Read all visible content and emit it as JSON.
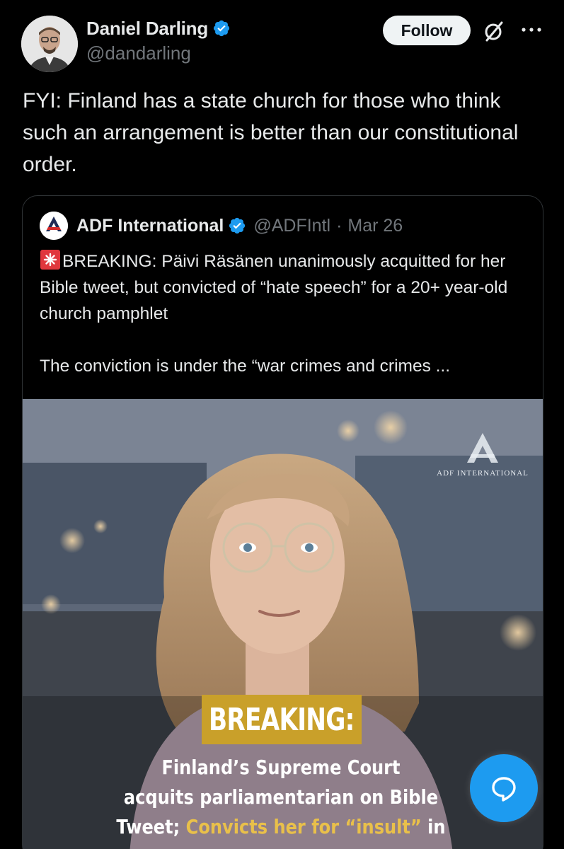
{
  "author": {
    "display_name": "Daniel Darling",
    "handle": "@dandarling",
    "verified": true
  },
  "actions": {
    "follow_label": "Follow"
  },
  "tweet": {
    "text": "FYI: Finland has a state church for those who think such an arrangement is better than our constitutional order."
  },
  "quote": {
    "author_name": "ADF International",
    "handle": "@ADFIntl",
    "separator": "·",
    "date": "Mar 26",
    "verified": true,
    "line1": "BREAKING: Päivi Räsänen unanimously acquitted for her Bible tweet, but convicted of “hate speech” for a 20+ year-old church pamphlet",
    "line2": "The conviction is under the “war crimes and crimes ..."
  },
  "media": {
    "watermark": "ADF INTERNATIONAL",
    "badge": "BREAKING:",
    "headline_1": "Finland’s Supreme Court",
    "headline_2": "acquits parliamentarian on Bible",
    "headline_3a": "Tweet;",
    "headline_3b": "Convicts her for “insult”",
    "headline_3c": "in"
  },
  "icons": {
    "verified": "verified-badge-icon",
    "grok": "grok-icon",
    "more": "more-icon",
    "siren": "siren-emoji-icon",
    "reply_fab": "chat-bubble-icon"
  },
  "colors": {
    "background": "#000000",
    "text": "#e7e9ea",
    "muted": "#71767b",
    "accent": "#1d9bf0",
    "badge": "#c9a02a",
    "headline_gold": "#e9c04a"
  }
}
